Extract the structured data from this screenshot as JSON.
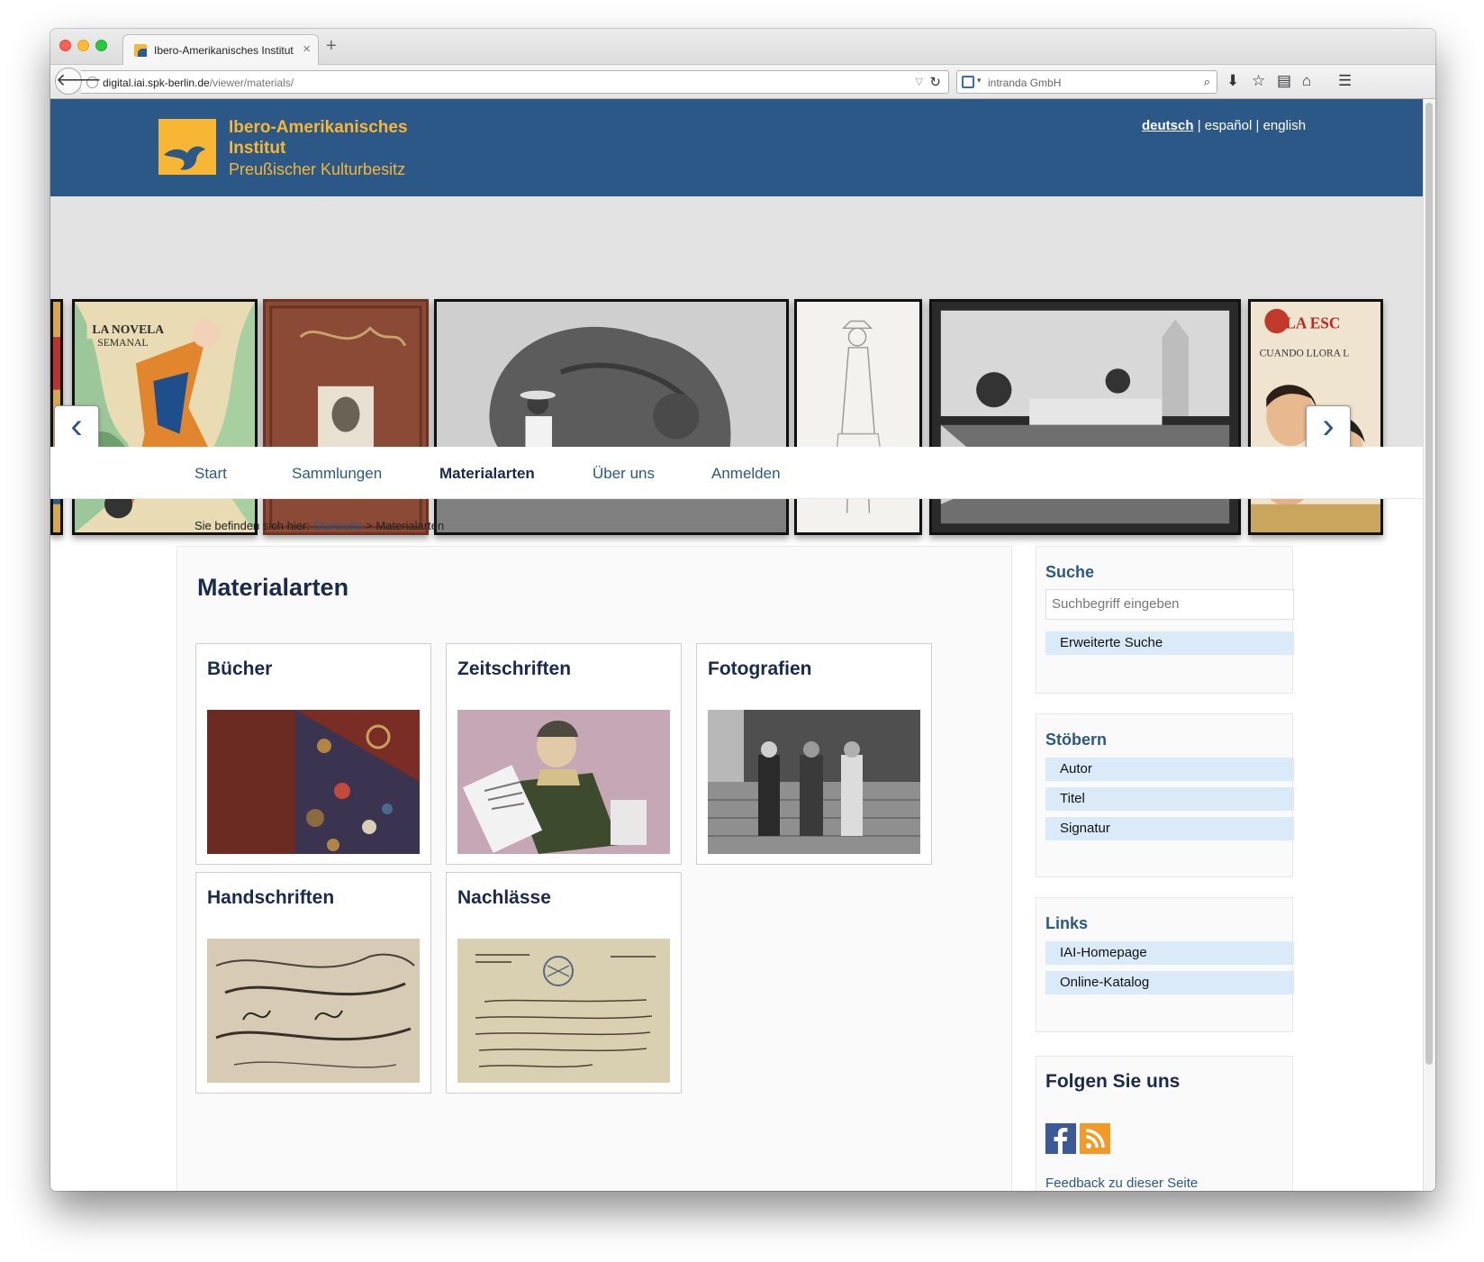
{
  "browser": {
    "tab_title": "Ibero-Amerikanisches Institut",
    "tab_close": "×",
    "new_tab": "+",
    "url_host": "digital.iai.spk-berlin.de",
    "url_path": "/viewer/materials/",
    "search_engine": "intranda GmbH"
  },
  "header": {
    "logo_line1": "Ibero-Amerikanisches",
    "logo_line2": "Institut",
    "logo_subtitle": "Preußischer Kulturbesitz",
    "languages": [
      "deutsch",
      "español",
      "english"
    ],
    "lang_sep": "|",
    "active_language": "deutsch"
  },
  "slider": {
    "prev_label": "‹",
    "next_label": "›"
  },
  "mainnav": {
    "items": [
      {
        "label": "Start"
      },
      {
        "label": "Sammlungen"
      },
      {
        "label": "Materialarten"
      },
      {
        "label": "Über uns"
      },
      {
        "label": "Anmelden"
      }
    ],
    "active": "Materialarten"
  },
  "breadcrumb": {
    "prefix": "Sie befinden sich hier:",
    "home": "Startseite",
    "separator": ">",
    "current": "Materialarten"
  },
  "content": {
    "title": "Materialarten",
    "cards": [
      {
        "title": "Bücher"
      },
      {
        "title": "Zeitschriften"
      },
      {
        "title": "Fotografien"
      },
      {
        "title": "Handschriften"
      },
      {
        "title": "Nachlässe"
      }
    ]
  },
  "sidebar": {
    "search": {
      "title": "Suche",
      "placeholder": "Suchbegriff eingeben",
      "advanced": "Erweiterte Suche"
    },
    "browse": {
      "title": "Stöbern",
      "items": [
        "Autor",
        "Titel",
        "Signatur"
      ]
    },
    "links": {
      "title": "Links",
      "items": [
        "IAI-Homepage",
        "Online-Katalog"
      ]
    },
    "follow": {
      "title": "Folgen Sie uns",
      "feedback": "Feedback zu dieser Seite"
    }
  },
  "colors": {
    "header_bg": "#2b5886",
    "logo_yellow": "#f7b634",
    "nav_link": "#2b5886",
    "title_dark": "#1a2a4c",
    "sidebar_item_bg": "#dbeaf8"
  },
  "icons": [
    "back-arrow-icon",
    "globe-icon",
    "reload-icon",
    "search-icon",
    "download-icon",
    "bookmark-star-icon",
    "reading-list-icon",
    "home-icon",
    "menu-icon",
    "facebook-icon",
    "rss-icon"
  ]
}
